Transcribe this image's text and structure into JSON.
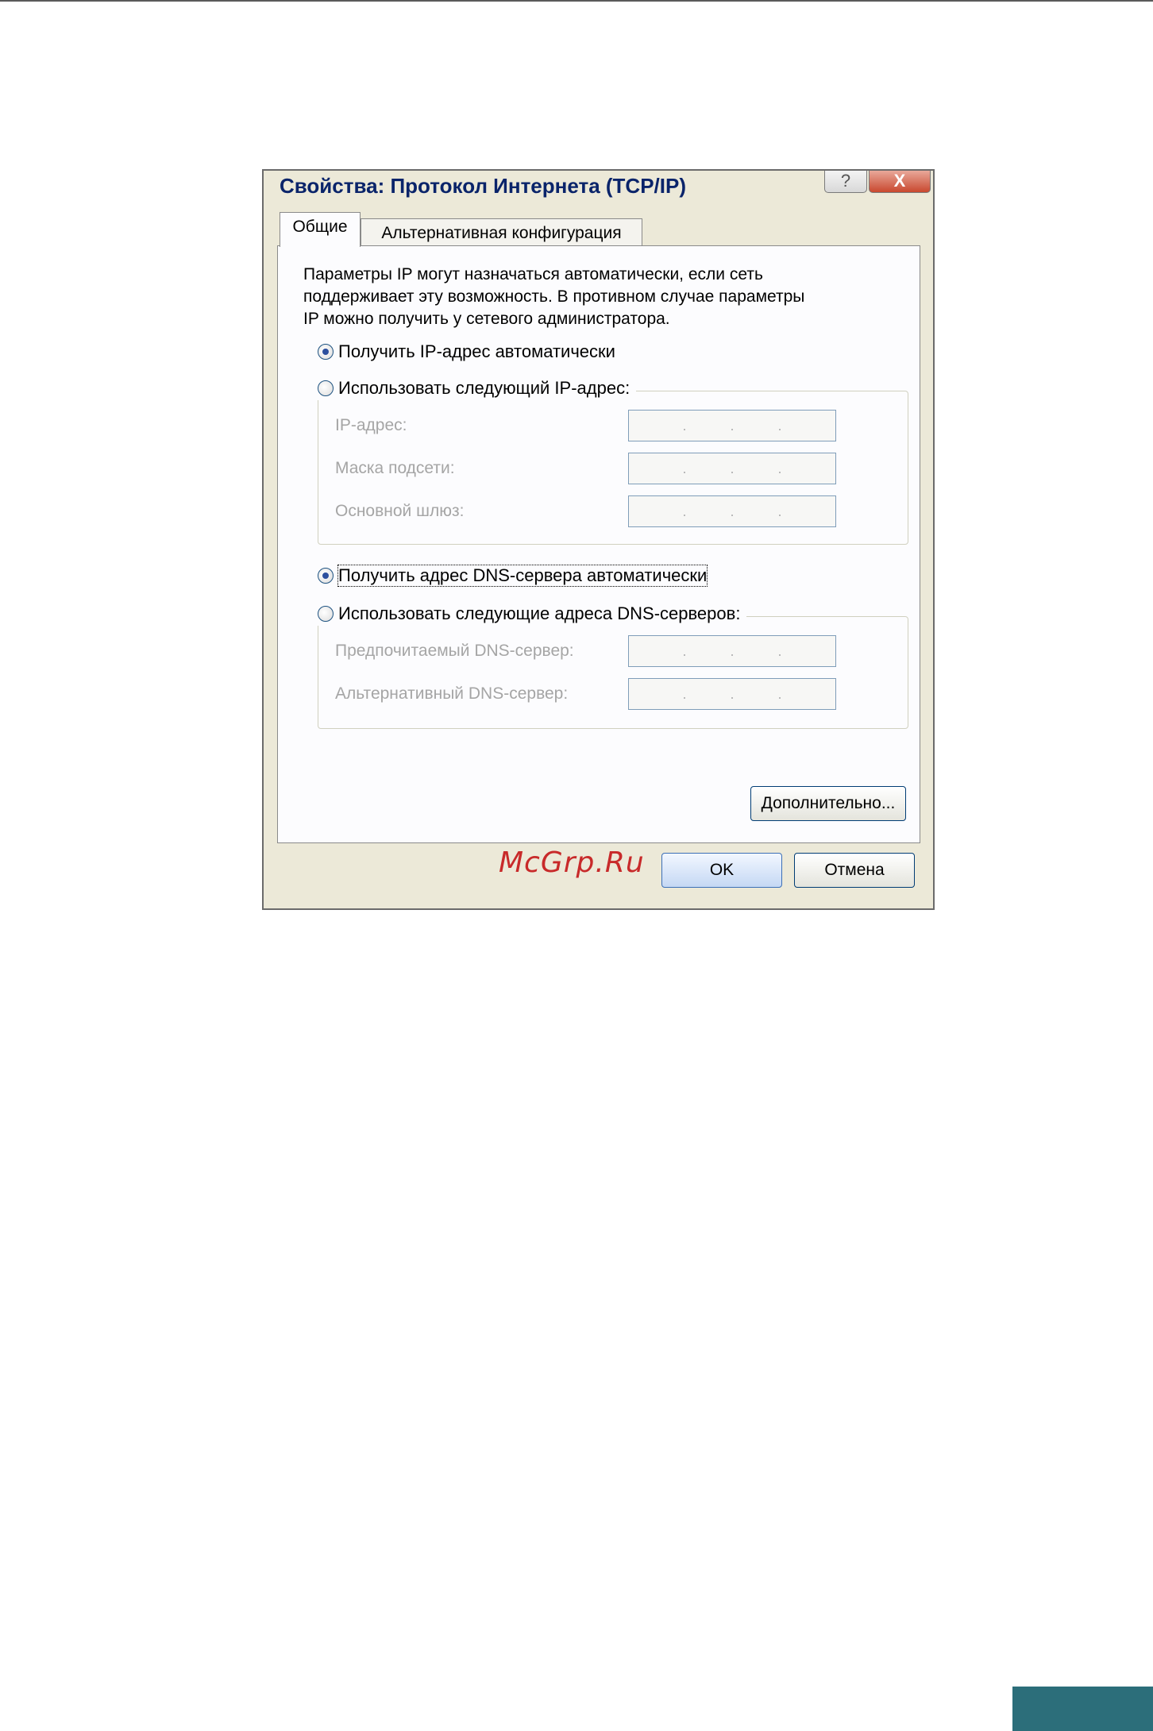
{
  "dialog": {
    "title": "Свойства: Протокол Интернета (TCP/IP)",
    "help_glyph": "?",
    "close_glyph": "X"
  },
  "tabs": [
    {
      "label": "Общие",
      "selected": true
    },
    {
      "label": "Альтернативная конфигурация",
      "selected": false
    }
  ],
  "general": {
    "description_lines": [
      "Параметры IP могут назначаться автоматически, если сеть",
      "поддерживает эту возможность. В противном случае параметры",
      "IP можно получить у сетевого администратора."
    ],
    "ip_auto": {
      "label": "Получить IP-адрес автоматически",
      "checked": true
    },
    "ip_manual": {
      "label": "Использовать следующий IP-адрес:",
      "checked": false
    },
    "ip_fields": [
      {
        "label": "IP-адрес:",
        "value": ". . ."
      },
      {
        "label": "Маска подсети:",
        "value": ". . ."
      },
      {
        "label": "Основной шлюз:",
        "value": ". . ."
      }
    ],
    "dns_auto": {
      "label": "Получить адрес DNS-сервера автоматически",
      "checked": true
    },
    "dns_manual": {
      "label": "Использовать следующие адреса DNS-серверов:",
      "checked": false
    },
    "dns_fields": [
      {
        "label": "Предпочитаемый DNS-сервер:",
        "value": ". . ."
      },
      {
        "label": "Альтернативный DNS-сервер:",
        "value": ". . ."
      }
    ],
    "advanced_button": "Дополнительно..."
  },
  "footer": {
    "ok_button": "OK",
    "cancel_button": "Отмена"
  },
  "watermark": "McGrp.Ru",
  "colors": {
    "title_text": "#0a246a",
    "dialog_bg": "#ece9d8",
    "panel_bg": "#fcfcfe",
    "disabled_text": "#a5a5a5",
    "watermark": "#c82a2a",
    "corner_tab": "#2c6e7a"
  }
}
